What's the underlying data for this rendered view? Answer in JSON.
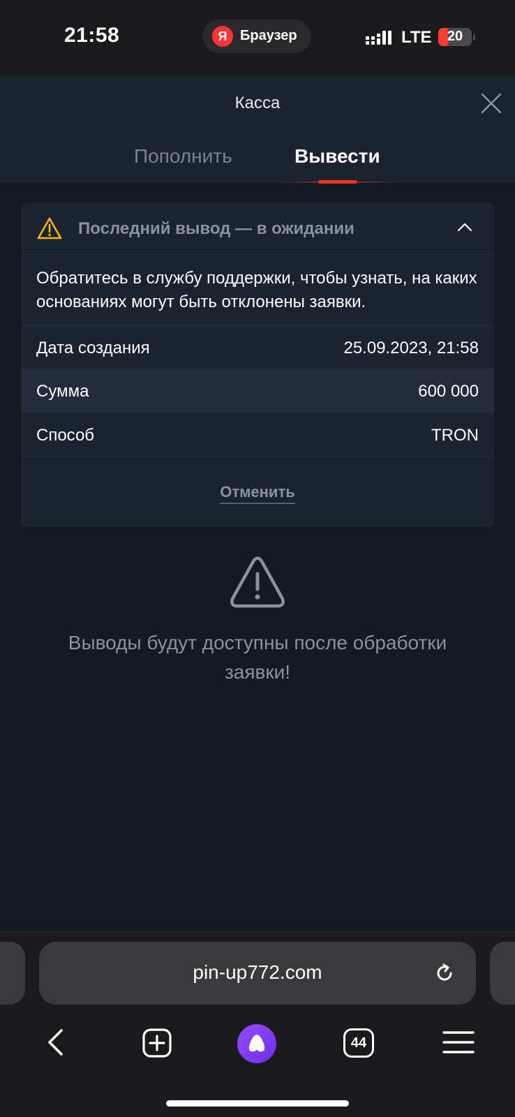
{
  "status_bar": {
    "time": "21:58",
    "browser_label": "Браузер",
    "browser_logo_letter": "Я",
    "network": "LTE",
    "battery": "20"
  },
  "header": {
    "title": "Касса"
  },
  "tabs": [
    {
      "label": "Пополнить",
      "active": false
    },
    {
      "label": "Вывести",
      "active": true
    }
  ],
  "withdrawal_card": {
    "status_title": "Последний вывод — в ожидании",
    "description": "Обратитесь в службу поддержки, чтобы узнать, на каких основаниях могут быть отклонены заявки.",
    "rows": [
      {
        "label": "Дата создания",
        "value": "25.09.2023, 21:58"
      },
      {
        "label": "Сумма",
        "value": "600 000"
      },
      {
        "label": "Способ",
        "value": "TRON"
      }
    ],
    "cancel_label": "Отменить"
  },
  "empty_state": {
    "message": "Выводы будут доступны после обработки заявки!"
  },
  "browser": {
    "url": "pin-up772.com",
    "tabs_count": "44"
  },
  "colors": {
    "background": "#141a24",
    "card": "#1b2230",
    "accent_red": "#ee3324",
    "warning_yellow": "#f5b800",
    "muted_text": "#8a92a0",
    "alice_purple": "#7b3ff2"
  },
  "icons": [
    "close-icon",
    "warning-icon",
    "chevron-up-icon",
    "reload-icon",
    "back-icon",
    "new-tab-icon",
    "alice-icon",
    "tabs-icon",
    "menu-icon"
  ]
}
